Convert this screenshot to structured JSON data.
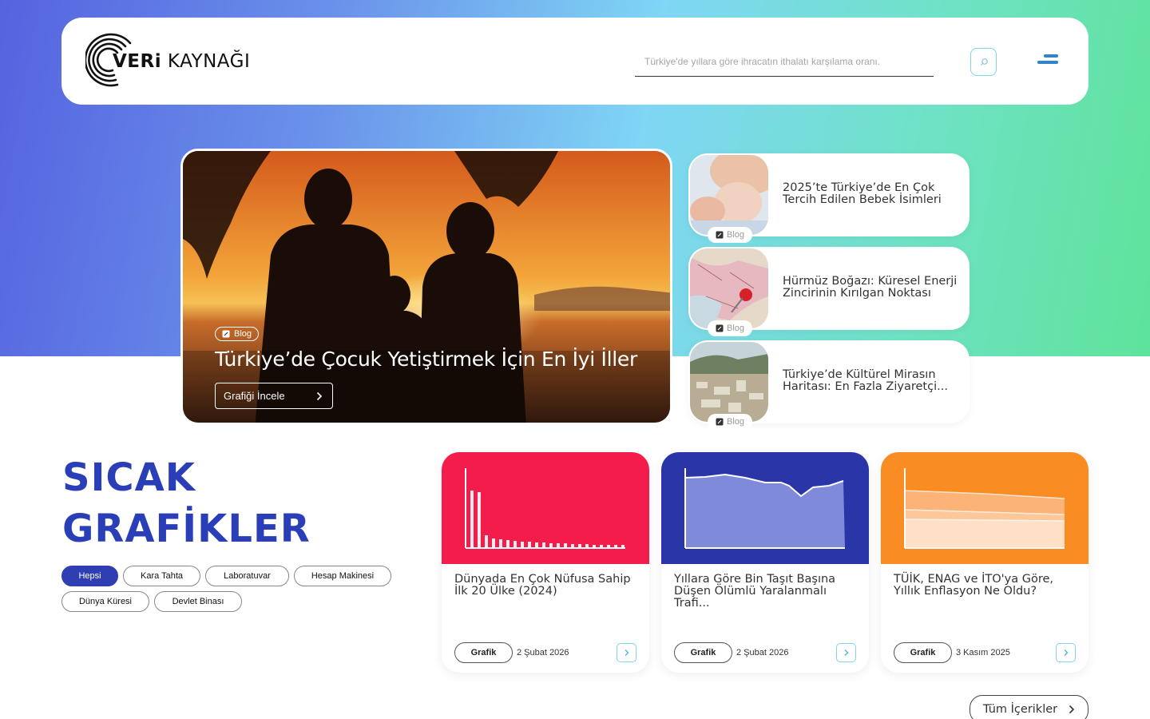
{
  "header": {
    "logo_bold": "VERi",
    "logo_light": "KAYNAĞI",
    "search_placeholder": "Türkiye'de yıllara göre ihracatın ithalatı karşılama oranı."
  },
  "featured": {
    "badge": "Blog",
    "title": "Türkiye’de Çocuk Yetiştirmek İçin En İyi İller",
    "button": "Grafiği İncele"
  },
  "side_posts": [
    {
      "badge": "Blog",
      "title": "2025’te Türkiye’de En Çok Tercih Edilen Bebek İsimleri"
    },
    {
      "badge": "Blog",
      "title": "Hürmüz Boğazı: Küresel Enerji Zincirinin Kırılgan Noktası"
    },
    {
      "badge": "Blog",
      "title": "Türkiye’de Kültürel Mirasın Haritası: En Fazla Ziyaretçi..."
    }
  ],
  "hot": {
    "title_line1": "SICAK",
    "title_line2": "GRAFİKLER",
    "filters": [
      "Hepsi",
      "Kara Tahta",
      "Laboratuvar",
      "Hesap Makinesi",
      "Dünya Küresi",
      "Devlet Binası"
    ],
    "active_filter": "Hepsi",
    "cards": [
      {
        "title": "Dünyada En Çok Nüfusa Sahip İlk 20 Ülke (2024)",
        "tag": "Grafik",
        "date": "2 Şubat 2026",
        "color": "#f21d4a"
      },
      {
        "title": "Yıllara Göre Bin Taşıt Başına Düşen Ölümlü Yaralanmalı Trafi...",
        "tag": "Grafik",
        "date": "2 Şubat 2026",
        "color": "#2a36a8"
      },
      {
        "title": "TÜİK, ENAG ve İTO'ya Göre, Yıllık Enflasyon Ne Oldu?",
        "tag": "Grafik",
        "date": "3 Kasım 2025",
        "color": "#f98c23"
      }
    ],
    "all_button": "Tüm İçerikler"
  },
  "colors": {
    "brand_blue": "#2a3fb7",
    "accent_cyan": "#7fd3ec",
    "menu_blue": "#2f84c7"
  }
}
